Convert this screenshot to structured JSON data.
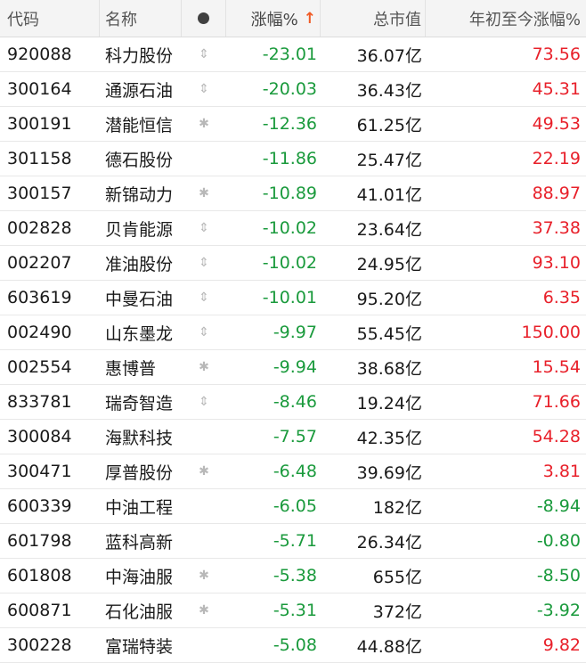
{
  "header": {
    "code": "代码",
    "name": "名称",
    "dot_icon": "dot-icon",
    "change": "涨幅%",
    "sort_icon": "arrow-up-icon",
    "sort_arrow": "↑",
    "mcap": "总市值",
    "ytd": "年初至今涨幅%"
  },
  "colors": {
    "up": "#e8202a",
    "down": "#1a9a3c",
    "sort_accent": "#f05a24"
  },
  "rows": [
    {
      "code": "920088",
      "name": "科力股份",
      "flag": "updown-icon",
      "flag_glyph": "⇕",
      "change": "-23.01",
      "mcap": "36.07亿",
      "ytd": "73.56"
    },
    {
      "code": "300164",
      "name": "通源石油",
      "flag": "updown-icon",
      "flag_glyph": "⇕",
      "change": "-20.03",
      "mcap": "36.43亿",
      "ytd": "45.31"
    },
    {
      "code": "300191",
      "name": "潜能恒信",
      "flag": "star-icon",
      "flag_glyph": "✱",
      "change": "-12.36",
      "mcap": "61.25亿",
      "ytd": "49.53"
    },
    {
      "code": "301158",
      "name": "德石股份",
      "flag": "",
      "flag_glyph": "",
      "change": "-11.86",
      "mcap": "25.47亿",
      "ytd": "22.19"
    },
    {
      "code": "300157",
      "name": "新锦动力",
      "flag": "star-icon",
      "flag_glyph": "✱",
      "change": "-10.89",
      "mcap": "41.01亿",
      "ytd": "88.97"
    },
    {
      "code": "002828",
      "name": "贝肯能源",
      "flag": "updown-icon",
      "flag_glyph": "⇕",
      "change": "-10.02",
      "mcap": "23.64亿",
      "ytd": "37.38"
    },
    {
      "code": "002207",
      "name": "准油股份",
      "flag": "updown-icon",
      "flag_glyph": "⇕",
      "change": "-10.02",
      "mcap": "24.95亿",
      "ytd": "93.10"
    },
    {
      "code": "603619",
      "name": "中曼石油",
      "flag": "updown-icon",
      "flag_glyph": "⇕",
      "change": "-10.01",
      "mcap": "95.20亿",
      "ytd": "6.35"
    },
    {
      "code": "002490",
      "name": "山东墨龙",
      "flag": "updown-icon",
      "flag_glyph": "⇕",
      "change": "-9.97",
      "mcap": "55.45亿",
      "ytd": "150.00"
    },
    {
      "code": "002554",
      "name": "惠博普",
      "flag": "star-icon",
      "flag_glyph": "✱",
      "change": "-9.94",
      "mcap": "38.68亿",
      "ytd": "15.54"
    },
    {
      "code": "833781",
      "name": "瑞奇智造",
      "flag": "updown-icon",
      "flag_glyph": "⇕",
      "change": "-8.46",
      "mcap": "19.24亿",
      "ytd": "71.66"
    },
    {
      "code": "300084",
      "name": "海默科技",
      "flag": "",
      "flag_glyph": "",
      "change": "-7.57",
      "mcap": "42.35亿",
      "ytd": "54.28"
    },
    {
      "code": "300471",
      "name": "厚普股份",
      "flag": "star-icon",
      "flag_glyph": "✱",
      "change": "-6.48",
      "mcap": "39.69亿",
      "ytd": "3.81"
    },
    {
      "code": "600339",
      "name": "中油工程",
      "flag": "",
      "flag_glyph": "",
      "change": "-6.05",
      "mcap": "182亿",
      "ytd": "-8.94"
    },
    {
      "code": "601798",
      "name": "蓝科高新",
      "flag": "",
      "flag_glyph": "",
      "change": "-5.71",
      "mcap": "26.34亿",
      "ytd": "-0.80"
    },
    {
      "code": "601808",
      "name": "中海油服",
      "flag": "star-icon",
      "flag_glyph": "✱",
      "change": "-5.38",
      "mcap": "655亿",
      "ytd": "-8.50"
    },
    {
      "code": "600871",
      "name": "石化油服",
      "flag": "star-icon",
      "flag_glyph": "✱",
      "change": "-5.31",
      "mcap": "372亿",
      "ytd": "-3.92"
    },
    {
      "code": "300228",
      "name": "富瑞特装",
      "flag": "",
      "flag_glyph": "",
      "change": "-5.08",
      "mcap": "44.88亿",
      "ytd": "9.82"
    }
  ]
}
